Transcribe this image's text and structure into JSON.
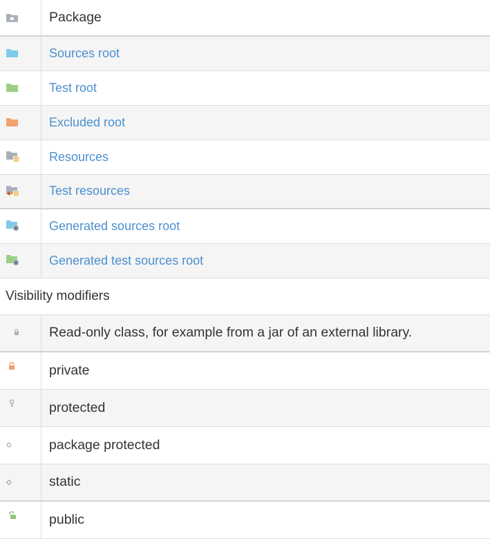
{
  "packages": [
    {
      "icon": "package-folder-icon",
      "label": "Package",
      "style": "plain"
    },
    {
      "icon": "sources-root-folder-icon",
      "label": "Sources root",
      "style": "link"
    },
    {
      "icon": "test-root-folder-icon",
      "label": "Test root",
      "style": "link"
    },
    {
      "icon": "excluded-root-folder-icon",
      "label": "Excluded root",
      "style": "link"
    },
    {
      "icon": "resources-folder-icon",
      "label": "Resources",
      "style": "link"
    },
    {
      "icon": "test-resources-folder-icon",
      "label": "Test resources",
      "style": "link"
    },
    {
      "icon": "generated-sources-root-folder-icon",
      "label": "Generated sources root",
      "style": "link"
    },
    {
      "icon": "generated-test-sources-root-folder-icon",
      "label": "Generated test sources root",
      "style": "link"
    }
  ],
  "section_heading": "Visibility modifiers",
  "visibility": [
    {
      "icon": "read-only-lock-icon",
      "label": "Read-only class, for example from a jar of an external library."
    },
    {
      "icon": "private-lock-icon",
      "label": "private"
    },
    {
      "icon": "protected-key-icon",
      "label": "protected"
    },
    {
      "icon": "package-protected-circle-icon",
      "label": "package protected"
    },
    {
      "icon": "static-diamond-icon",
      "label": "static"
    },
    {
      "icon": "public-unlock-icon",
      "label": "public"
    }
  ],
  "colors": {
    "link": "#4a90cf",
    "sources_folder": "#7ecbeb",
    "test_folder": "#9ccf86",
    "excluded_folder": "#f2a36e",
    "package_folder": "#a9b0b8",
    "private": "#f0a070",
    "public": "#8cc77a"
  }
}
